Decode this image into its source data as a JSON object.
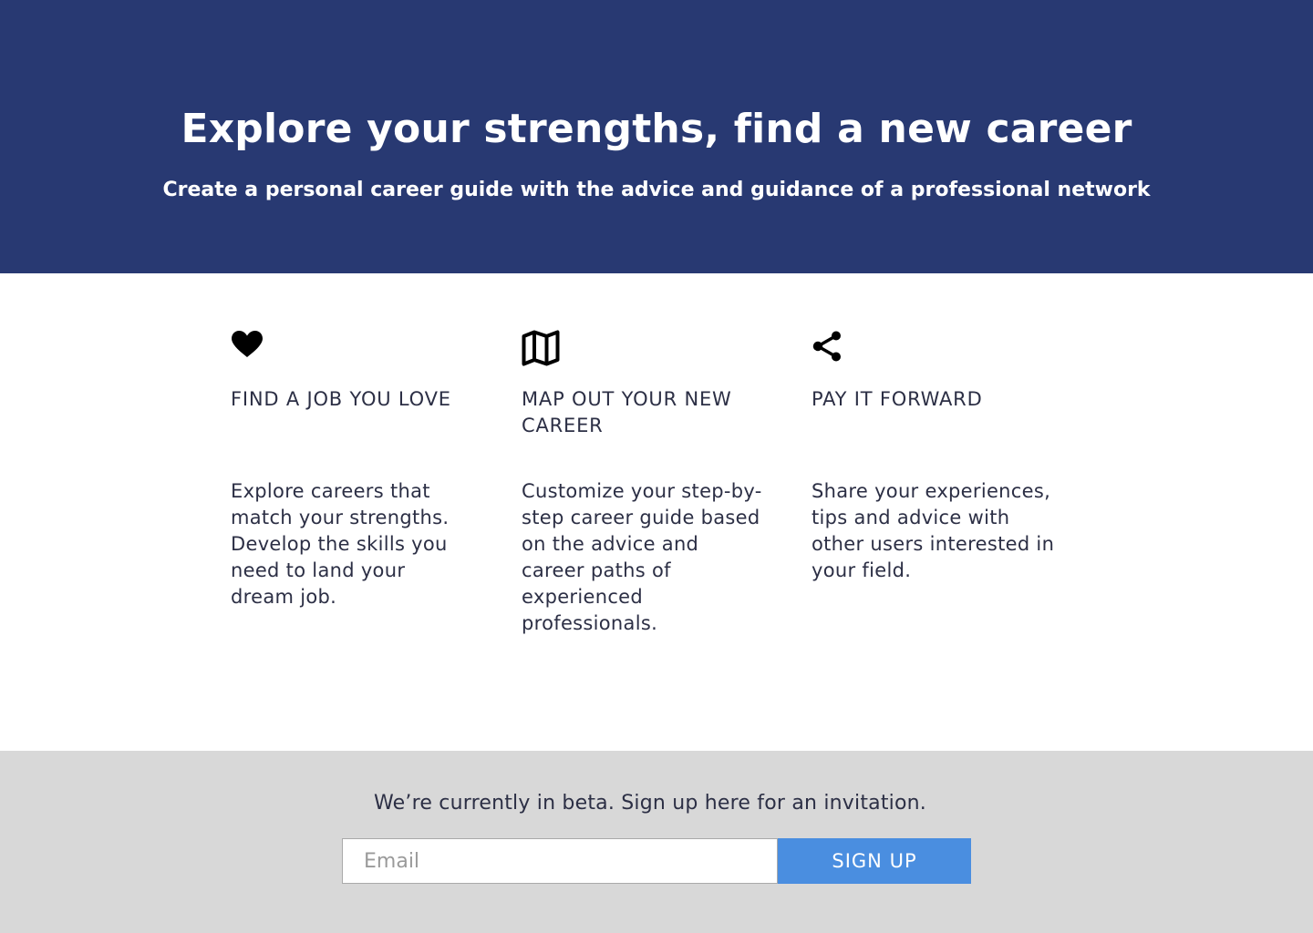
{
  "hero": {
    "title": "Explore your strengths, find a new career",
    "subtitle": "Create a personal career guide with the advice and guidance of a professional network",
    "background_color": "#283972"
  },
  "features": [
    {
      "icon": "heart-icon",
      "heading": "FIND A JOB YOU LOVE",
      "text": "Explore careers that match your strengths. Develop the skills you need to land your dream job."
    },
    {
      "icon": "map-icon",
      "heading": "MAP OUT YOUR NEW CAREER",
      "text": "Customize your step-by-step career guide based on the advice and career paths of experienced professionals."
    },
    {
      "icon": "share-icon",
      "heading": "PAY IT FORWARD",
      "text": "Share your experiences, tips and advice with other users interested in your field."
    }
  ],
  "signup": {
    "message": "We’re currently in beta. Sign up here for an invitation.",
    "email_placeholder": "Email",
    "email_value": "",
    "button_label": "SIGN UP",
    "button_color": "#4a8ee0",
    "background_color": "#d8d8d8"
  }
}
